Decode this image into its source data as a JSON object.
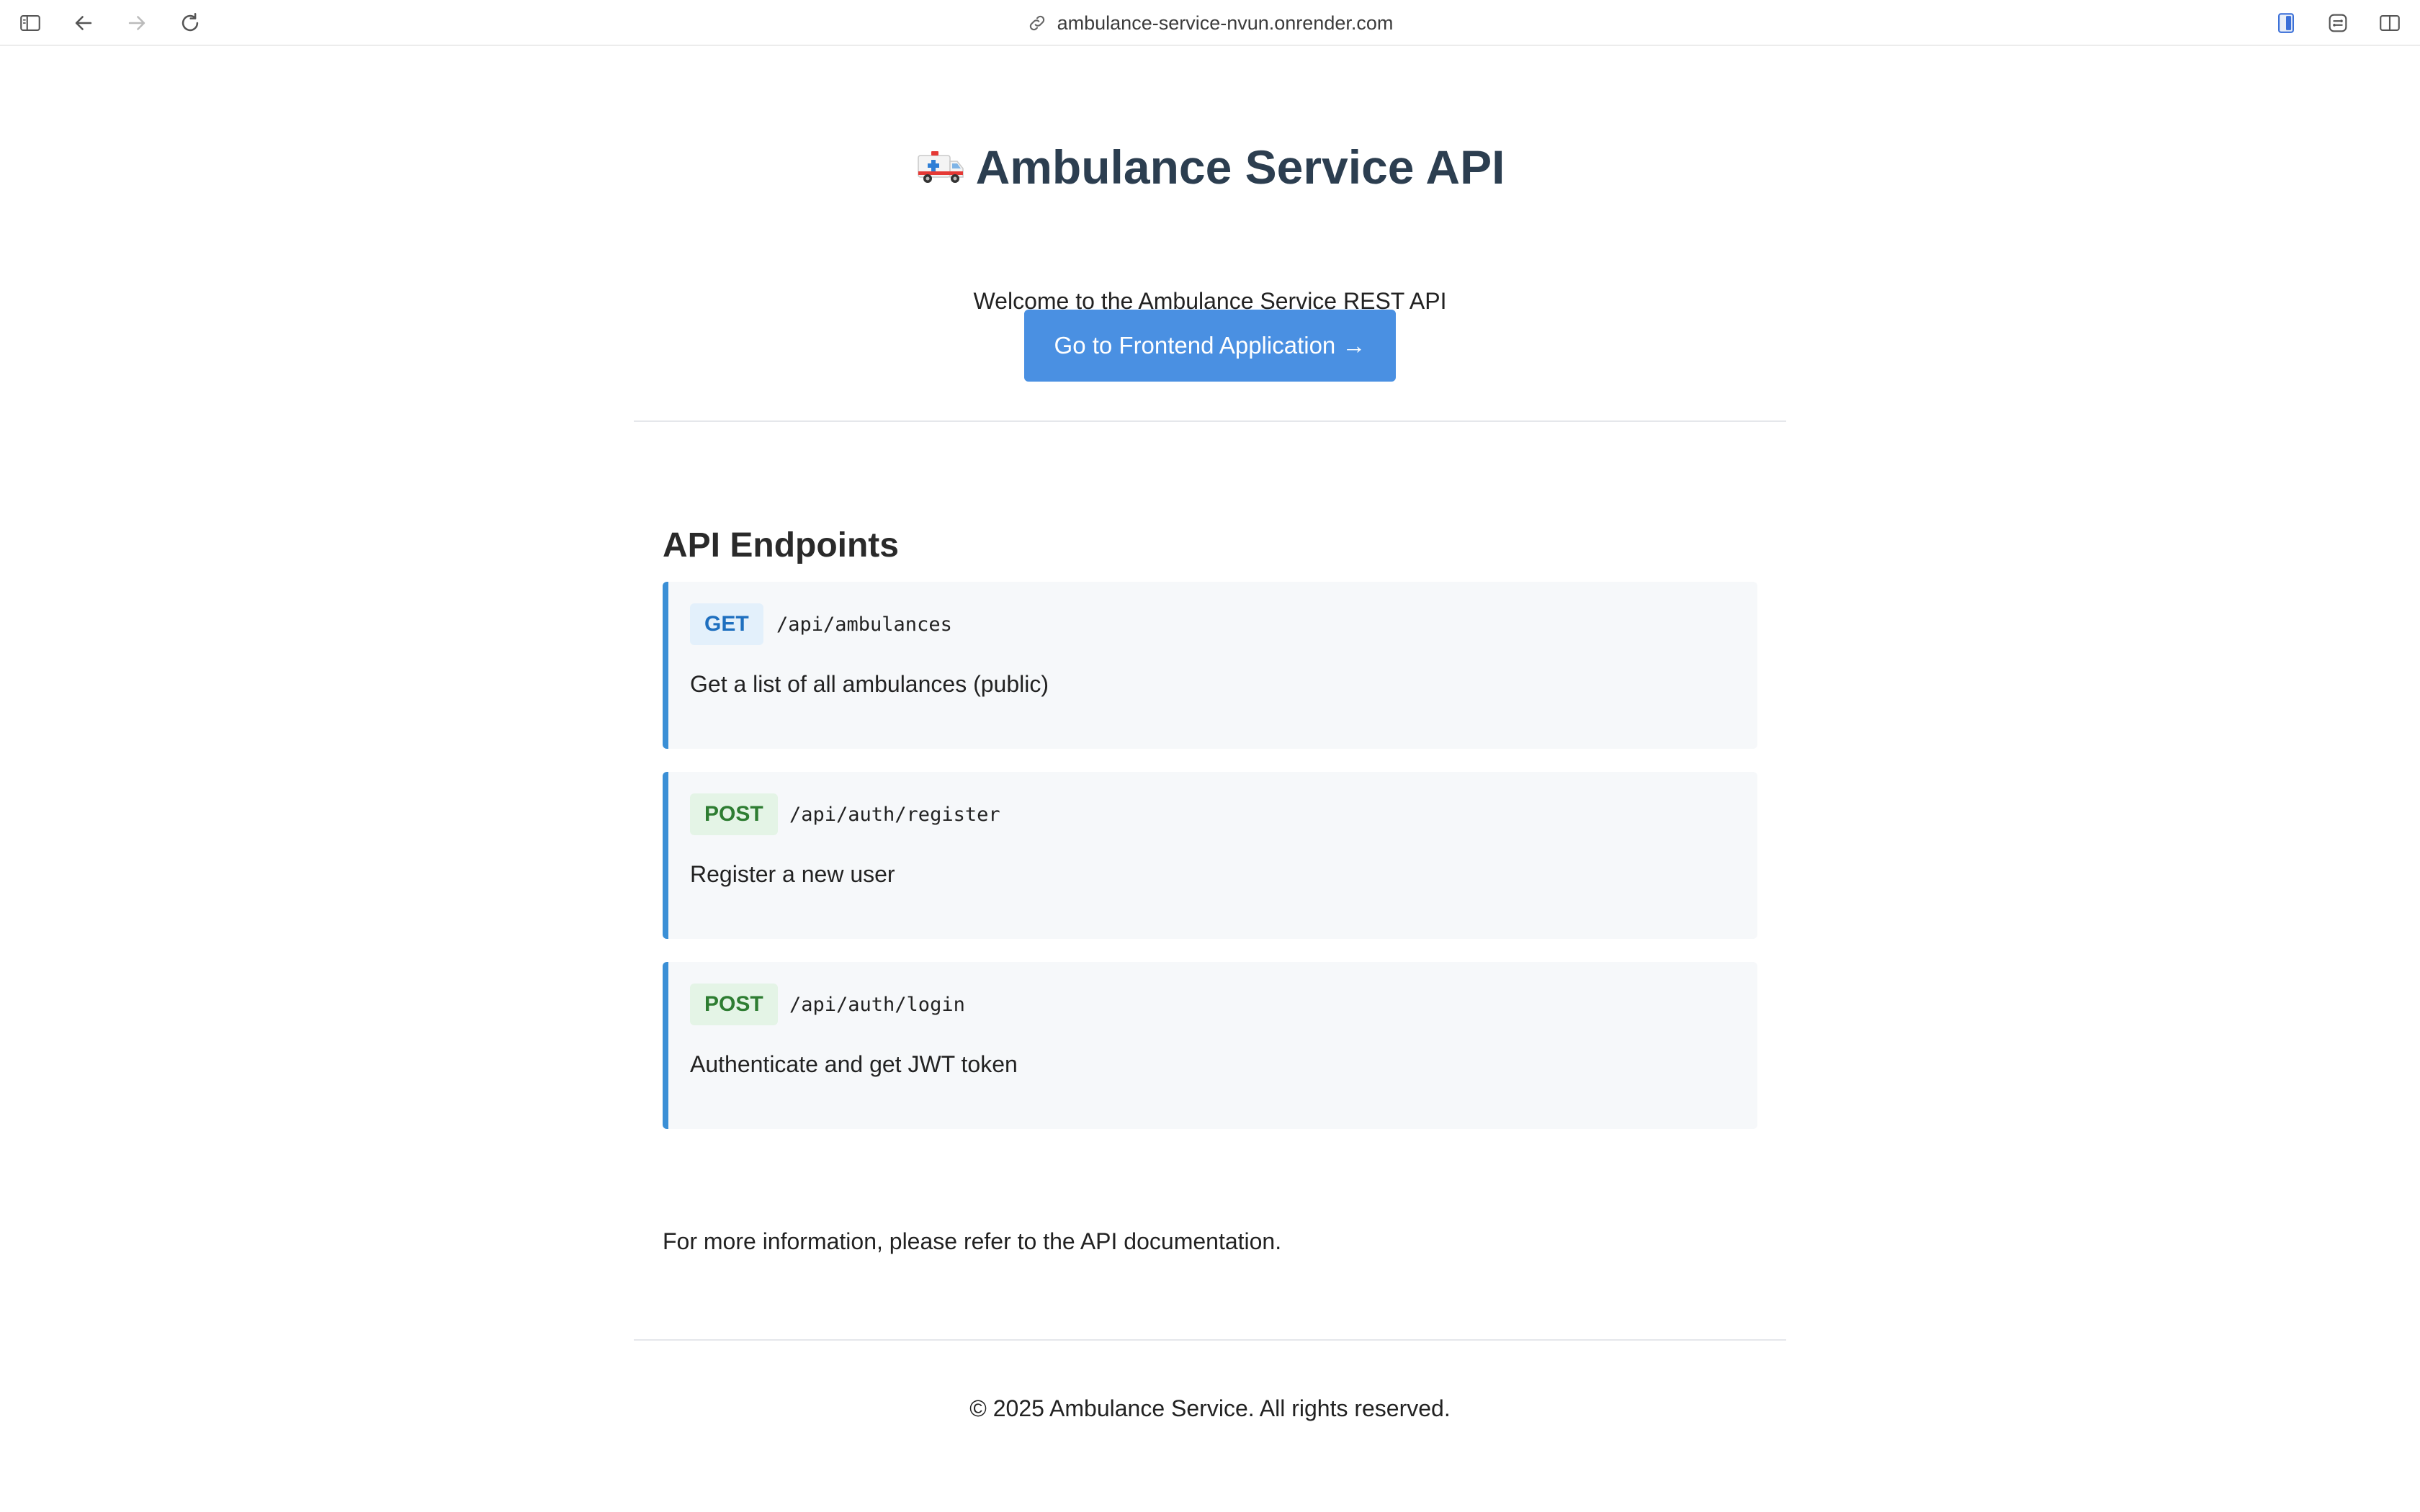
{
  "browser": {
    "url": "ambulance-service-nvun.onrender.com",
    "icons": [
      "sidebar-icon",
      "back-icon",
      "forward-icon",
      "reload-icon",
      "link-icon",
      "extension-icon",
      "tracker-icon",
      "split-view-icon"
    ]
  },
  "header": {
    "title": "Ambulance Service API",
    "subtitle": "Welcome to the Ambulance Service REST API",
    "cta_label": "Go to Frontend Application →"
  },
  "main": {
    "section_title": "API Endpoints",
    "endpoints": [
      {
        "method": "GET",
        "path": "/api/ambulances",
        "description": "Get a list of all ambulances (public)"
      },
      {
        "method": "POST",
        "path": "/api/auth/register",
        "description": "Register a new user"
      },
      {
        "method": "POST",
        "path": "/api/auth/login",
        "description": "Authenticate and get JWT token"
      }
    ],
    "more_info": "For more information, please refer to the API documentation."
  },
  "footer": {
    "text": "© 2025 Ambulance Service. All rights reserved."
  },
  "colors": {
    "accent": "#4a90e2",
    "endpoint_border": "#3a8fd6",
    "get_text": "#1e6fbf",
    "post_text": "#2e7d32",
    "title": "#2c3e50"
  }
}
